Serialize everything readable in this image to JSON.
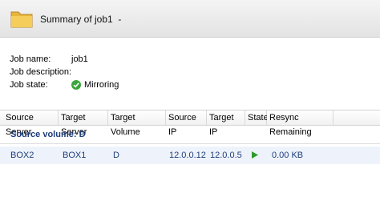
{
  "window": {
    "title": "Summary of job1",
    "title_suffix": "-",
    "icon": "folder-icon"
  },
  "job": {
    "name_label": "Job name:",
    "name_value": "job1",
    "description_label": "Job description:",
    "description_value": "",
    "state_label": "Job state:",
    "state_value": "Mirroring",
    "state_icon": "check-icon",
    "state_color": "#3aa53a"
  },
  "grid": {
    "columns": [
      "Source Server",
      "Target Server",
      "Target Volume",
      "Source IP",
      "Target IP",
      "State",
      "Resync Remaining"
    ],
    "group_label": "Source volume: D",
    "rows": [
      {
        "source_server": "BOX2",
        "target_server": "BOX1",
        "target_volume": "D",
        "source_ip": "12.0.0.12",
        "target_ip": "12.0.0.5",
        "state_icon": "play-icon",
        "resync_remaining": "0.00 KB"
      }
    ],
    "accent": "#1f3d7a",
    "state_color": "#2e9a2e"
  }
}
